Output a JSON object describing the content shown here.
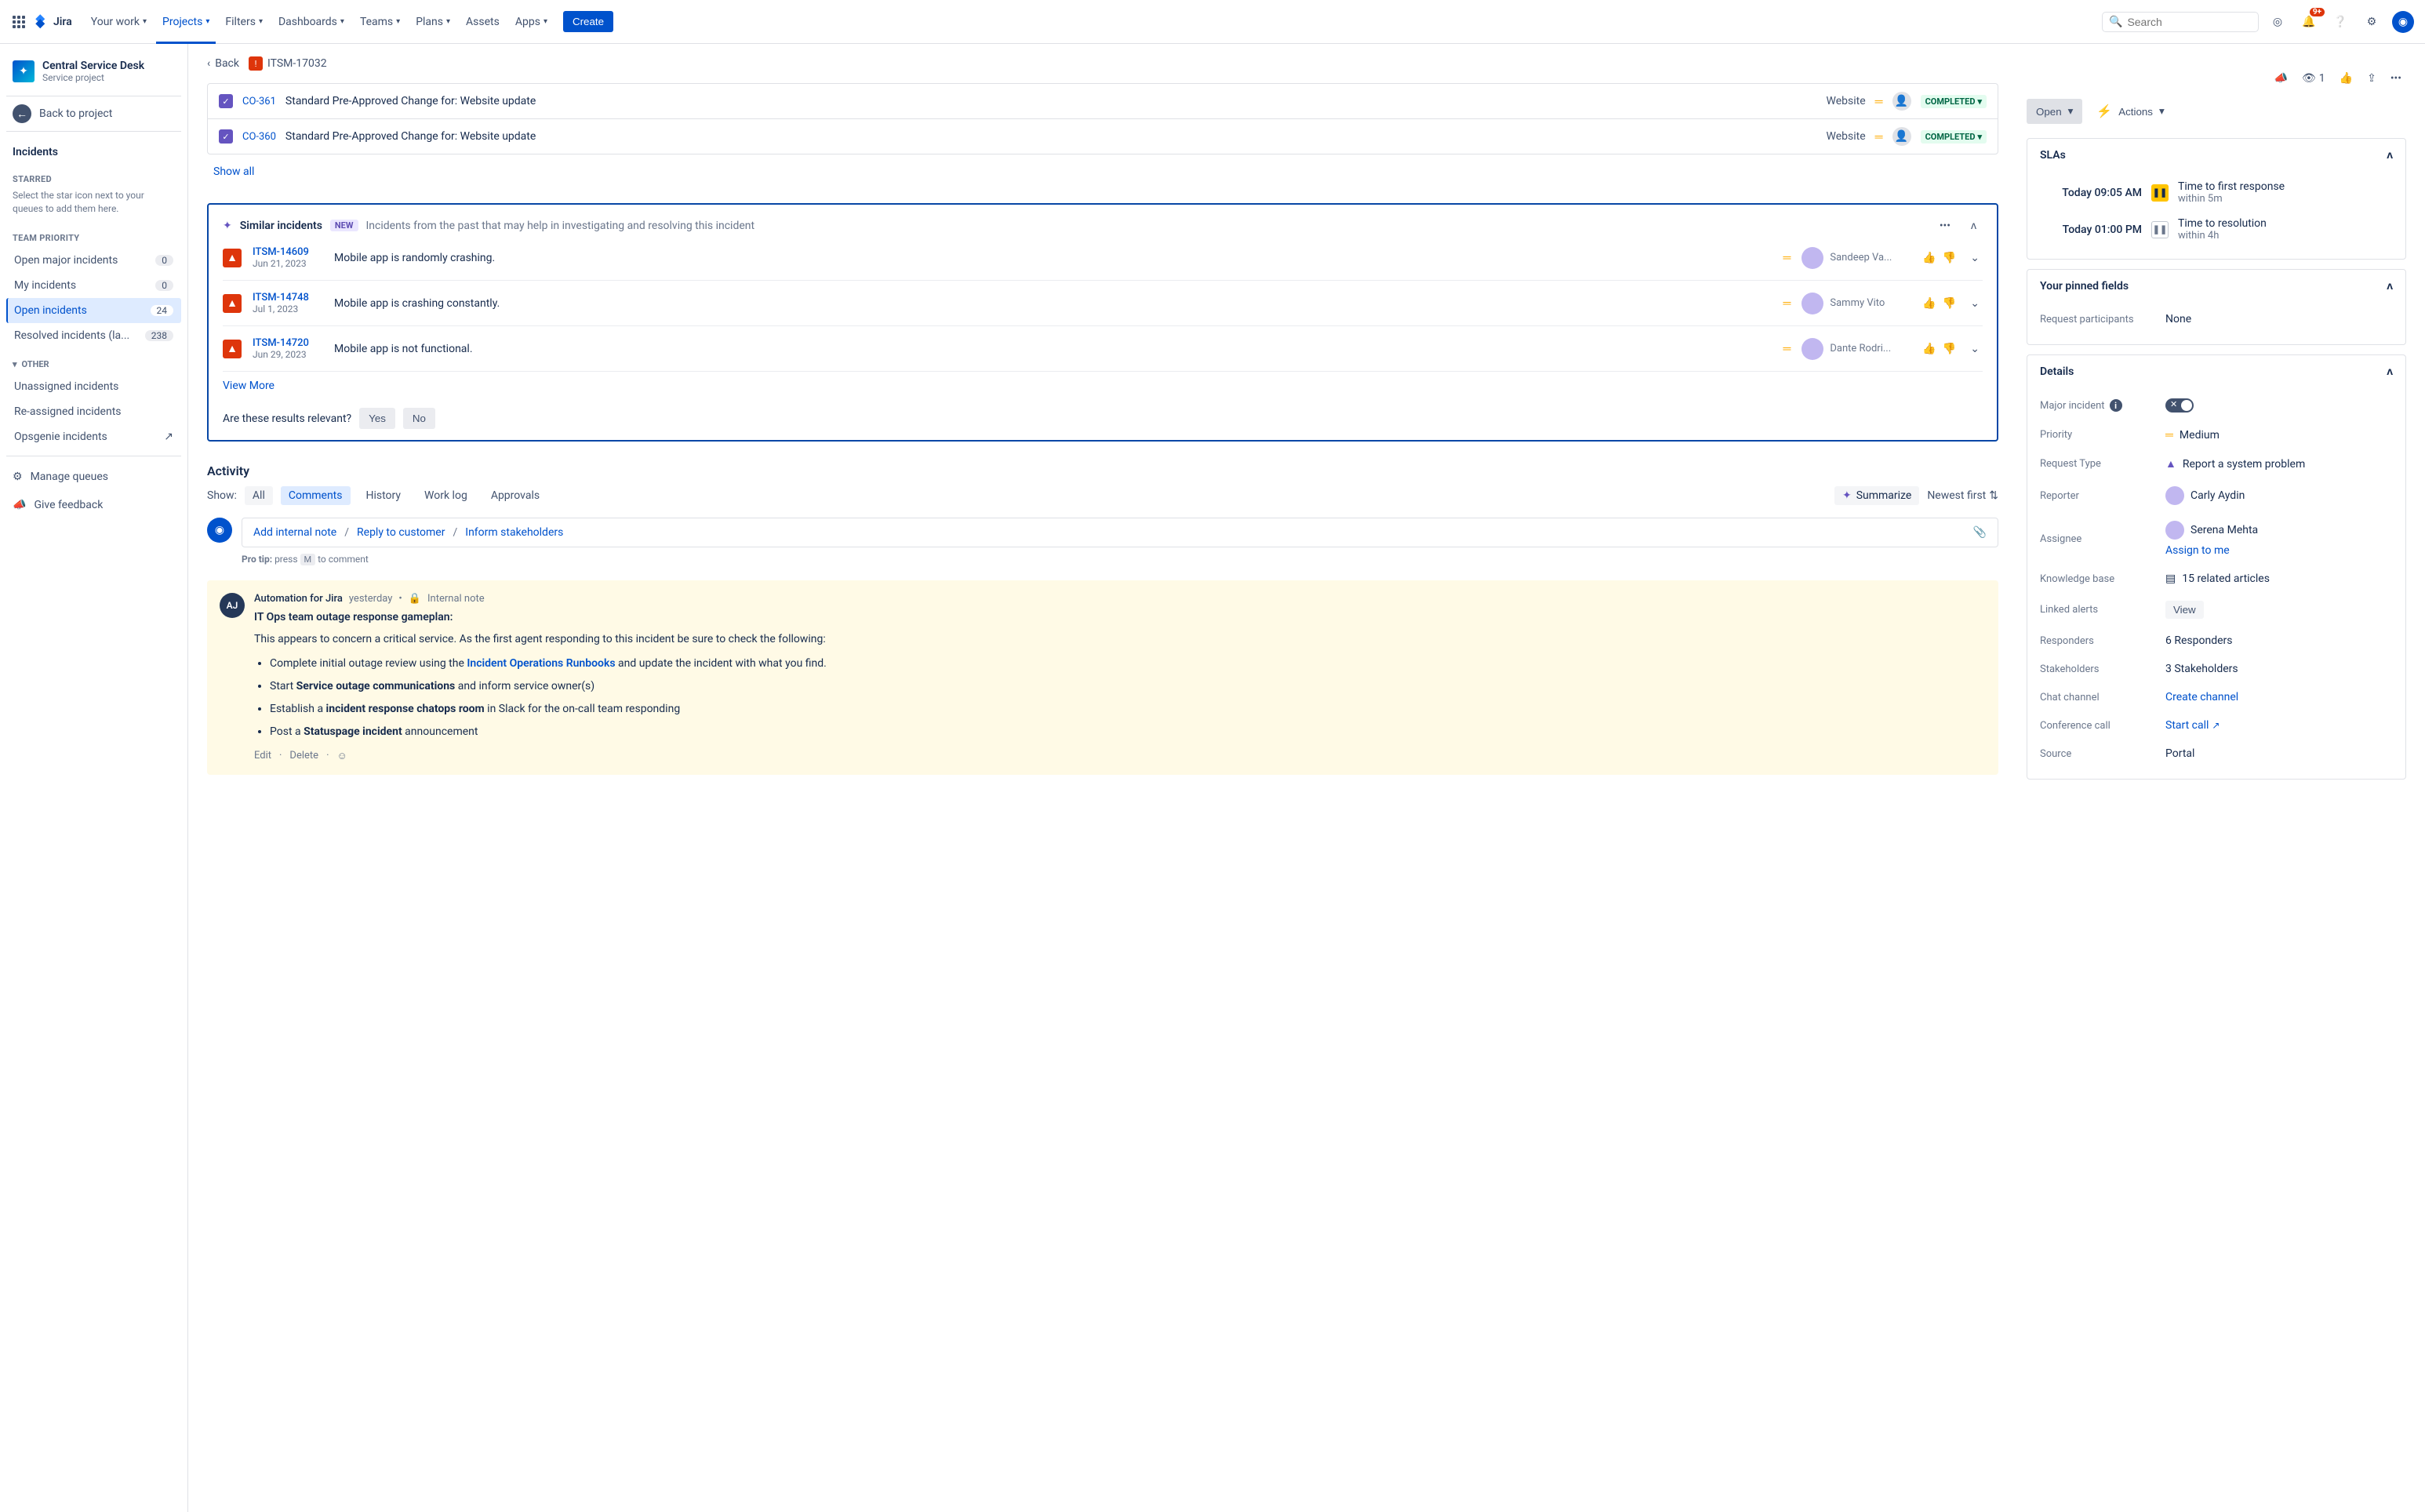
{
  "topnav": {
    "logo": "Jira",
    "items": [
      "Your work",
      "Projects",
      "Filters",
      "Dashboards",
      "Teams",
      "Plans",
      "Assets",
      "Apps"
    ],
    "active_index": 1,
    "create": "Create",
    "search_placeholder": "Search",
    "notif_badge": "9+"
  },
  "sidebar": {
    "project_name": "Central Service Desk",
    "project_type": "Service project",
    "back": "Back to project",
    "heading": "Incidents",
    "starred_group": "STARRED",
    "starred_hint": "Select the star icon next to your queues to add them here.",
    "team_priority_group": "TEAM PRIORITY",
    "queues": [
      {
        "label": "Open major incidents",
        "count": "0"
      },
      {
        "label": "My incidents",
        "count": "0"
      },
      {
        "label": "Open incidents",
        "count": "24"
      },
      {
        "label": "Resolved incidents (la...",
        "count": "238"
      }
    ],
    "active_queue_index": 2,
    "other_group": "OTHER",
    "other_items": [
      "Unassigned incidents",
      "Re-assigned incidents",
      "Opsgenie incidents"
    ],
    "manage_queues": "Manage queues",
    "give_feedback": "Give feedback"
  },
  "crumb": {
    "back": "Back",
    "issue_key": "ITSM-17032"
  },
  "linked": {
    "rows": [
      {
        "key": "CO-361",
        "title": "Standard Pre-Approved Change for: Website update",
        "dest": "Website",
        "status": "COMPLETED"
      },
      {
        "key": "CO-360",
        "title": "Standard Pre-Approved Change for: Website update",
        "dest": "Website",
        "status": "COMPLETED"
      }
    ],
    "show_all": "Show all"
  },
  "similar": {
    "title": "Similar incidents",
    "chip": "NEW",
    "desc": "Incidents from the past that may help in investigating and resolving this incident",
    "rows": [
      {
        "key": "ITSM-14609",
        "date": "Jun 21, 2023",
        "summary": "Mobile app is randomly crashing.",
        "person": "Sandeep Va..."
      },
      {
        "key": "ITSM-14748",
        "date": "Jul 1, 2023",
        "summary": "Mobile app is crashing constantly.",
        "person": "Sammy Vito"
      },
      {
        "key": "ITSM-14720",
        "date": "Jun 29, 2023",
        "summary": "Mobile app is not functional.",
        "person": "Dante Rodri..."
      }
    ],
    "view_more": "View More",
    "relevance_q": "Are these results relevant?",
    "yes": "Yes",
    "no": "No"
  },
  "activity": {
    "heading": "Activity",
    "show_label": "Show:",
    "tabs": [
      "All",
      "Comments",
      "History",
      "Work log",
      "Approvals"
    ],
    "active_tab_index": 1,
    "summarize": "Summarize",
    "sort": "Newest first",
    "compose": {
      "add_internal": "Add internal note",
      "reply": "Reply to customer",
      "inform": "Inform stakeholders"
    },
    "pro_tip_prefix": "Pro tip:",
    "pro_tip_press": "press",
    "pro_tip_key": "M",
    "pro_tip_suffix": "to comment",
    "comment": {
      "avatar_initials": "AJ",
      "author": "Automation for Jira",
      "time": "yesterday",
      "internal": "Internal note",
      "title": "IT Ops team outage response gameplan:",
      "para": "This appears to concern a critical service. As the first agent responding to this incident be sure to check the following:",
      "bullets_pre": [
        "Complete initial outage review using the ",
        "Start ",
        "Establish a ",
        "Post a "
      ],
      "bullets_link": [
        "Incident Operations Runbooks",
        "",
        "",
        ""
      ],
      "bullets_bold": [
        "",
        "Service outage communications",
        "incident response chatops room",
        "Statuspage incident"
      ],
      "bullets_post": [
        " and update the incident with what you find.",
        " and inform service owner(s)",
        " in Slack for the on-call team responding",
        " announcement"
      ],
      "edit": "Edit",
      "delete": "Delete"
    }
  },
  "right": {
    "watch_count": "1",
    "status": "Open",
    "actions": "Actions",
    "slas_title": "SLAs",
    "slas": [
      {
        "time": "Today 09:05 AM",
        "pause": "yellow",
        "name": "Time to first response",
        "within": "within 5m"
      },
      {
        "time": "Today 01:00 PM",
        "pause": "grey",
        "name": "Time to resolution",
        "within": "within 4h"
      }
    ],
    "pinned_title": "Your pinned fields",
    "pinned_field": "Request participants",
    "pinned_value": "None",
    "details_title": "Details",
    "fields": {
      "major_incident": "Major incident",
      "priority": "Priority",
      "priority_val": "Medium",
      "request_type": "Request Type",
      "request_type_val": "Report a system problem",
      "reporter": "Reporter",
      "reporter_val": "Carly Aydin",
      "assignee": "Assignee",
      "assignee_val": "Serena Mehta",
      "assign_to_me": "Assign to me",
      "kb": "Knowledge base",
      "kb_val": "15 related articles",
      "linked_alerts": "Linked alerts",
      "linked_alerts_val": "View",
      "responders": "Responders",
      "responders_val": "6 Responders",
      "stakeholders": "Stakeholders",
      "stakeholders_val": "3 Stakeholders",
      "chat": "Chat channel",
      "chat_val": "Create channel",
      "conf": "Conference call",
      "conf_val": "Start call",
      "source": "Source",
      "source_val": "Portal"
    }
  }
}
